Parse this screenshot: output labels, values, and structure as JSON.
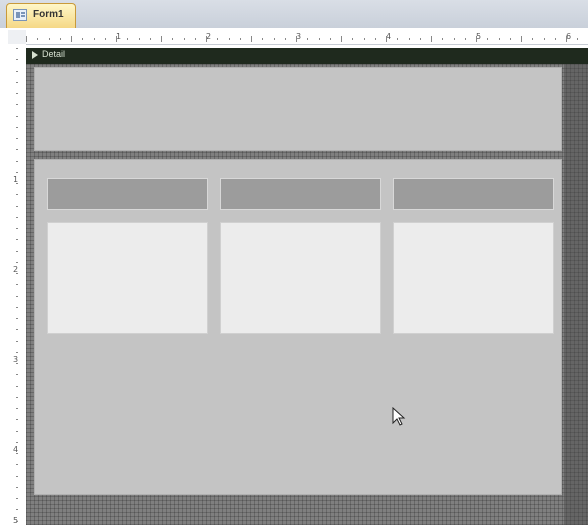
{
  "tab": {
    "label": "Form1",
    "icon": "form-icon"
  },
  "section": {
    "label": "Detail"
  },
  "rulers": {
    "horizontal": [
      "1",
      "2",
      "3",
      "4",
      "5",
      "6"
    ],
    "vertical": [
      "1",
      "2",
      "3",
      "4",
      "5"
    ]
  },
  "colors": {
    "section_bar": "#1f2a1e",
    "form_body": "#c4c4c4",
    "header_block": "#9c9c9c",
    "cell_block": "#ececec",
    "tab_accent": "#f5d886"
  }
}
